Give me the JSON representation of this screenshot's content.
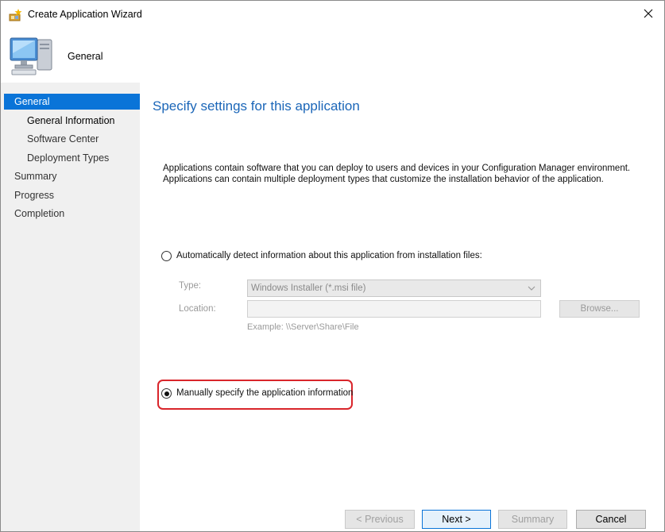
{
  "window": {
    "title": "Create Application Wizard",
    "icon": "wizard-sparkle-icon",
    "close_glyph": "✕"
  },
  "header": {
    "title": "General",
    "icon": "computer-monitor-icon"
  },
  "nav": {
    "items": [
      {
        "label": "General",
        "state": "active"
      },
      {
        "label": "General Information",
        "state": "current"
      },
      {
        "label": "Software Center",
        "state": "normal"
      },
      {
        "label": "Deployment Types",
        "state": "normal"
      },
      {
        "label": "Summary",
        "state": "normal"
      },
      {
        "label": "Progress",
        "state": "normal"
      },
      {
        "label": "Completion",
        "state": "normal"
      }
    ]
  },
  "main": {
    "heading": "Specify settings for this application",
    "description_line1": "Applications contain software that you can deploy to users and devices in your Configuration Manager environment.",
    "description_line2": "Applications can contain multiple deployment types that customize the installation behavior of the application.",
    "auto_detect": {
      "label": "Automatically detect information about this application from installation files:",
      "selected": false,
      "type_label": "Type:",
      "type_value": "Windows Installer (*.msi file)",
      "location_label": "Location:",
      "location_value": "",
      "browse_label": "Browse...",
      "example": "Example: \\\\Server\\Share\\File"
    },
    "manual": {
      "label": "Manually specify the application information",
      "selected": true
    }
  },
  "footer": {
    "previous_label": "< Previous",
    "next_label": "Next >",
    "summary_label": "Summary",
    "cancel_label": "Cancel"
  },
  "colors": {
    "accent": "#0a74d8",
    "heading": "#1b66b8",
    "highlight": "#d9252b",
    "nav_background": "#f0f0f0"
  }
}
